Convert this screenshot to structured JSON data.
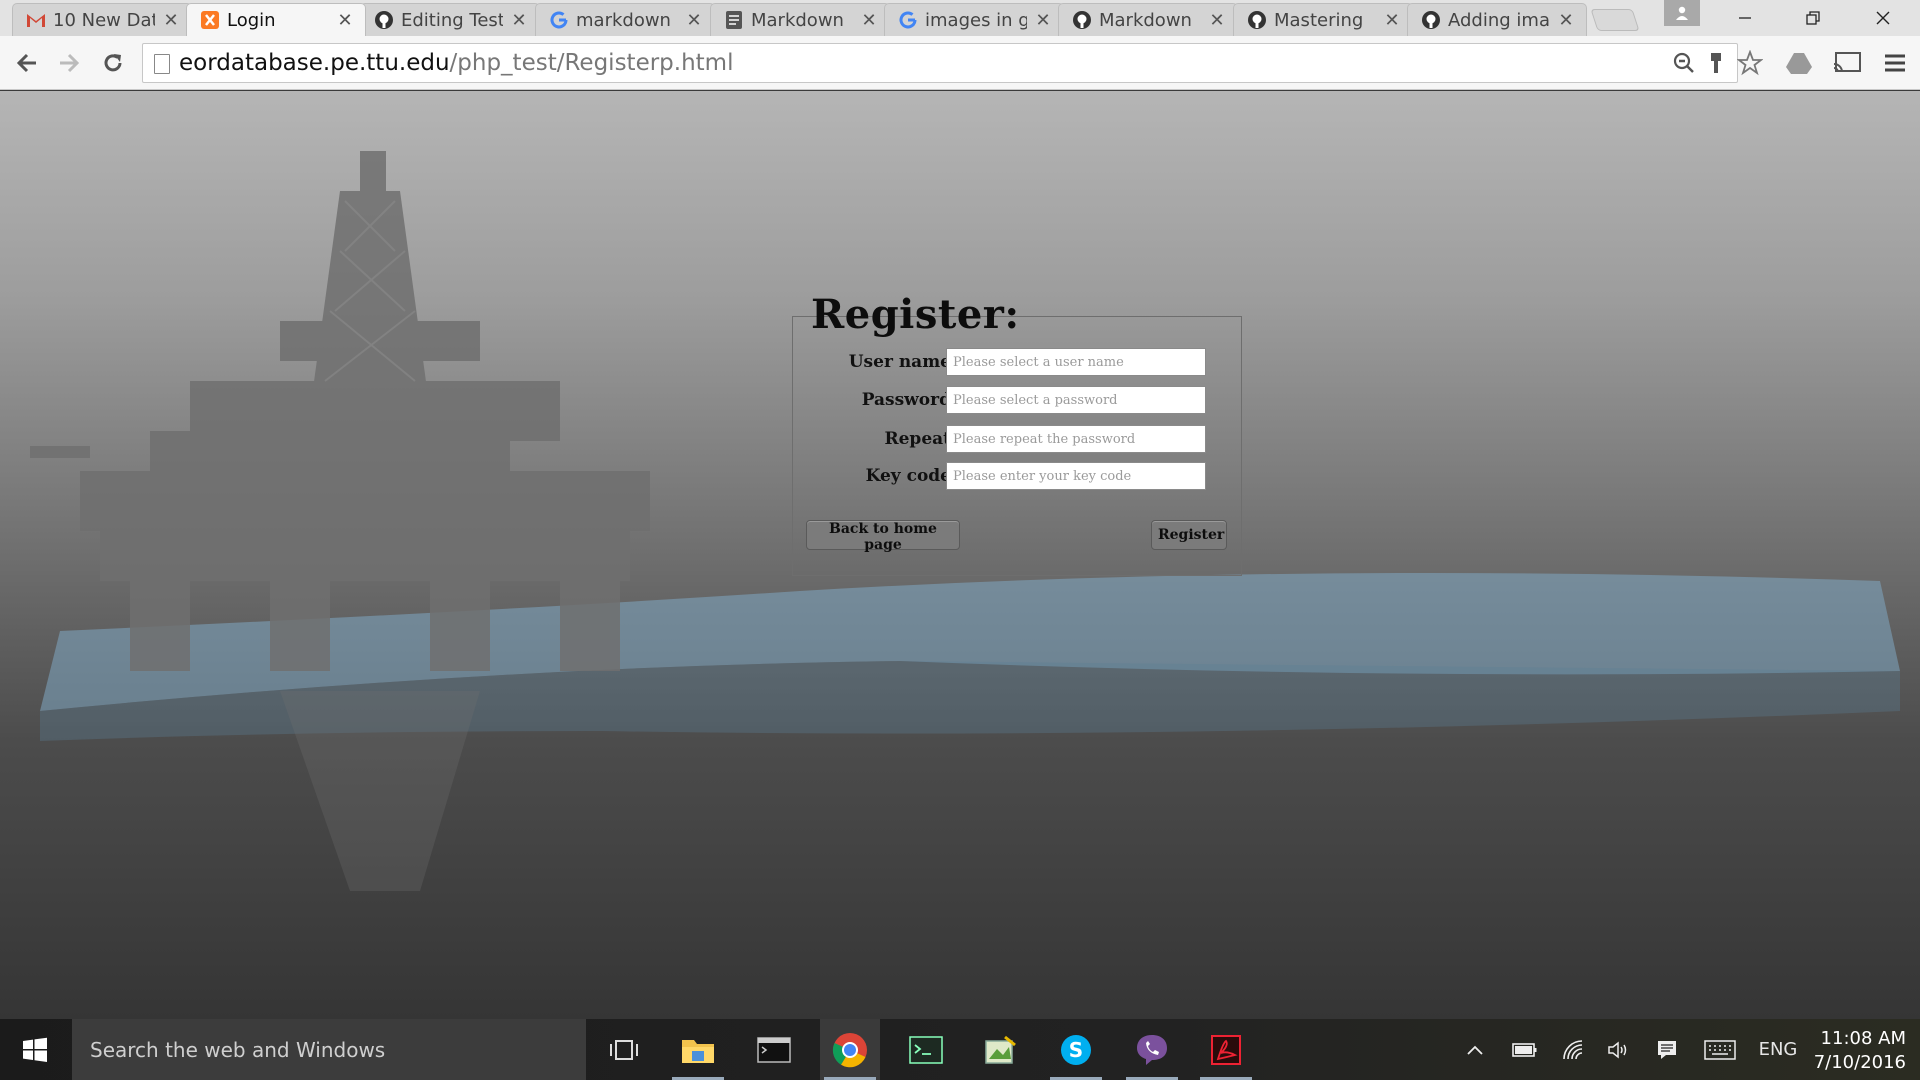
{
  "browser": {
    "tabs": [
      {
        "title": "10 New Dat",
        "icon": "gmail-icon",
        "active": false
      },
      {
        "title": "Login",
        "icon": "xampp-icon",
        "active": true
      },
      {
        "title": "Editing Test",
        "icon": "github-icon",
        "active": false
      },
      {
        "title": "markdown",
        "icon": "google-icon",
        "active": false
      },
      {
        "title": "Markdown",
        "icon": "doc-icon",
        "active": false
      },
      {
        "title": "images in g",
        "icon": "google-icon",
        "active": false
      },
      {
        "title": "Markdown",
        "icon": "github-icon",
        "active": false
      },
      {
        "title": "Mastering",
        "icon": "github-icon",
        "active": false
      },
      {
        "title": "Adding ima",
        "icon": "github-icon",
        "active": false
      }
    ],
    "url_host": "eordatabase.pe.ttu.edu",
    "url_path": "/php_test/Registerp.html"
  },
  "form": {
    "legend": "Register:",
    "fields": [
      {
        "label": "User name",
        "placeholder": "Please select a user name",
        "value": ""
      },
      {
        "label": "Password",
        "placeholder": "Please select a password",
        "value": ""
      },
      {
        "label": "Repeat",
        "placeholder": "Please repeat the password",
        "value": ""
      },
      {
        "label": "Key code",
        "placeholder": "Please enter your key code",
        "value": ""
      }
    ],
    "back_label": "Back to home page",
    "submit_label": "Register"
  },
  "taskbar": {
    "search_placeholder": "Search the web and Windows",
    "language": "ENG",
    "time": "11:08 AM",
    "date": "7/10/2016"
  },
  "colors": {
    "gmail": "#d14836",
    "xampp": "#fb7a24",
    "chrome_red": "#db4437",
    "chrome_green": "#0f9d58",
    "chrome_yellow": "#f4b400",
    "chrome_blue": "#4285f4",
    "skype": "#00aff0",
    "viber": "#7b519d",
    "sea": "#7fa7c2"
  }
}
